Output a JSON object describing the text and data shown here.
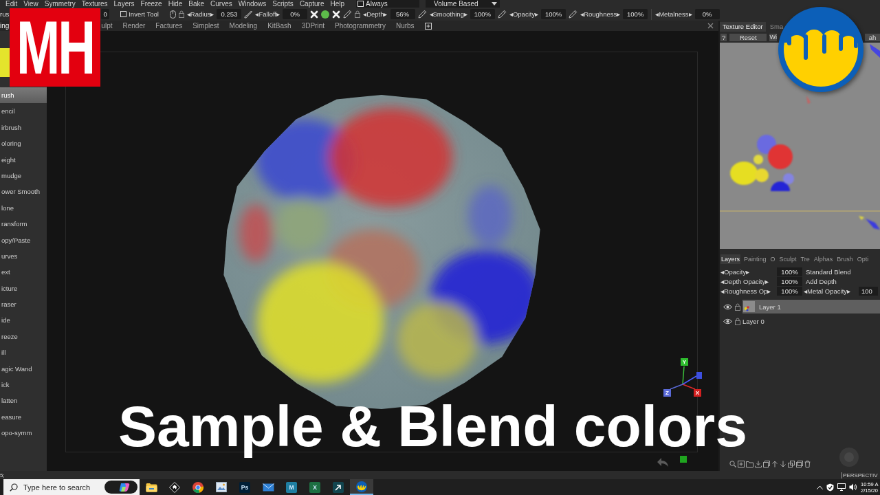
{
  "menu_bar": {
    "items": [
      "Edit",
      "View",
      "Symmetry",
      "Textures",
      "Layers",
      "Freeze",
      "Hide",
      "Bake",
      "Curves",
      "Windows",
      "Scripts",
      "Capture",
      "Help"
    ],
    "always": {
      "label": "Always",
      "checked": false
    },
    "mode": {
      "value": "Volume Based"
    }
  },
  "toolbar": {
    "tool_button": "rus",
    "value_field": "0",
    "invert_tool": {
      "label": "Invert Tool",
      "checked": false
    },
    "spinners": [
      {
        "label": "◂Radius▸",
        "value": "0.253"
      },
      {
        "label": "◂Falloff▸",
        "value": "0%"
      },
      {
        "label": "◂Depth▸",
        "value": "56%"
      },
      {
        "label": "◂Smoothing▸",
        "value": "100%"
      },
      {
        "label": "◂Opacity▸",
        "value": "100%"
      },
      {
        "label": "◂Roughness▸",
        "value": "100%"
      },
      {
        "label": "◂Metalness▸",
        "value": "0%"
      }
    ]
  },
  "workspace_tabs": [
    {
      "label": "ing",
      "selected": true
    },
    {
      "label": "ulpt",
      "selected": false
    },
    {
      "label": "Render",
      "selected": false
    },
    {
      "label": "Factures",
      "selected": false
    },
    {
      "label": "Simplest",
      "selected": false
    },
    {
      "label": "Modeling",
      "selected": false
    },
    {
      "label": "KitBash",
      "selected": false
    },
    {
      "label": "3DPrint",
      "selected": false
    },
    {
      "label": "Photogrammetry",
      "selected": false
    },
    {
      "label": "Nurbs",
      "selected": false
    }
  ],
  "sidebar": {
    "tools": [
      {
        "label": "rush",
        "selected": true
      },
      {
        "label": "encil",
        "selected": false
      },
      {
        "label": "irbrush",
        "selected": false
      },
      {
        "label": "oloring",
        "selected": false
      },
      {
        "label": "eight",
        "selected": false
      },
      {
        "label": "mudge",
        "selected": false
      },
      {
        "label": "ower Smooth",
        "selected": false
      },
      {
        "label": "lone",
        "selected": false
      },
      {
        "label": "ransform",
        "selected": false
      },
      {
        "label": "opy/Paste",
        "selected": false
      },
      {
        "label": "urves",
        "selected": false
      },
      {
        "label": "ext",
        "selected": false
      },
      {
        "label": "icture",
        "selected": false
      },
      {
        "label": "raser",
        "selected": false
      },
      {
        "label": "ide",
        "selected": false
      },
      {
        "label": "reeze",
        "selected": false
      },
      {
        "label": "ill",
        "selected": false
      },
      {
        "label": "agic Wand",
        "selected": false
      },
      {
        "label": "ick",
        "selected": false
      },
      {
        "label": "latten",
        "selected": false
      },
      {
        "label": "easure",
        "selected": false
      },
      {
        "label": "opo-symm",
        "selected": false
      }
    ]
  },
  "viewport": {
    "axis_labels": [
      {
        "label": "Y",
        "color": "#2fbf2f"
      },
      {
        "label": "Z",
        "color": "#5a6ad8"
      },
      {
        "label": "X",
        "color": "#d42020"
      }
    ]
  },
  "caption": "Sample & Blend colors",
  "channel_logo": "MH",
  "right_panel": {
    "tabs": [
      {
        "label": "Texture Editor",
        "selected": true
      },
      {
        "label": "Sma",
        "selected": false
      }
    ],
    "buttons": [
      "?",
      "Reset",
      "Wi",
      "ah"
    ]
  },
  "layers_panel": {
    "tabs": [
      {
        "label": "Layers",
        "selected": true
      },
      {
        "label": "Painting",
        "selected": false
      },
      {
        "label": "O",
        "selected": false
      },
      {
        "label": "Sculpt",
        "selected": false
      },
      {
        "label": "Tre",
        "selected": false
      },
      {
        "label": "Alphas",
        "selected": false
      },
      {
        "label": "Brush",
        "selected": false
      },
      {
        "label": "Opti",
        "selected": false
      }
    ],
    "properties": [
      {
        "kind": "blend",
        "label": "◂Opacity▸",
        "value": "100%",
        "mode": "Standard Blend"
      },
      {
        "kind": "blend",
        "label": "◂Depth Opacity▸",
        "value": "100%",
        "mode": "Add Depth"
      },
      {
        "kind": "pair",
        "label": "◂Roughness Op▸",
        "value": "100%",
        "label_2": "◂Metal Opacity▸",
        "value_2": "100"
      }
    ],
    "layers": [
      {
        "name": "Layer 1",
        "selected": true,
        "visible": true,
        "thumbnail": true
      },
      {
        "name": "Layer 0",
        "selected": false,
        "visible": true,
        "thumbnail": false
      }
    ]
  },
  "status_bar": {
    "text": "5;",
    "view_label": "PERSPECTIV"
  },
  "taskbar": {
    "search": {
      "placeholder": "Type here to search"
    },
    "apps": [
      {
        "kind": "folder",
        "selected": false
      },
      {
        "kind": "diamond",
        "selected": false
      },
      {
        "kind": "browser",
        "selected": false
      },
      {
        "kind": "image",
        "selected": false
      },
      {
        "kind": "tile",
        "glyph": "Ps",
        "color": "#001e36",
        "selected": false
      },
      {
        "kind": "mail",
        "selected": false
      },
      {
        "kind": "tile",
        "glyph": "M",
        "color": "#1f7ea1",
        "selected": false
      },
      {
        "kind": "tile",
        "glyph": "X",
        "color": "#1d6f42",
        "selected": false
      },
      {
        "kind": "arrow",
        "selected": false
      },
      {
        "kind": "drip",
        "selected": true
      }
    ],
    "clock": {
      "time": "10:59 A",
      "date": "2/15/20"
    }
  }
}
